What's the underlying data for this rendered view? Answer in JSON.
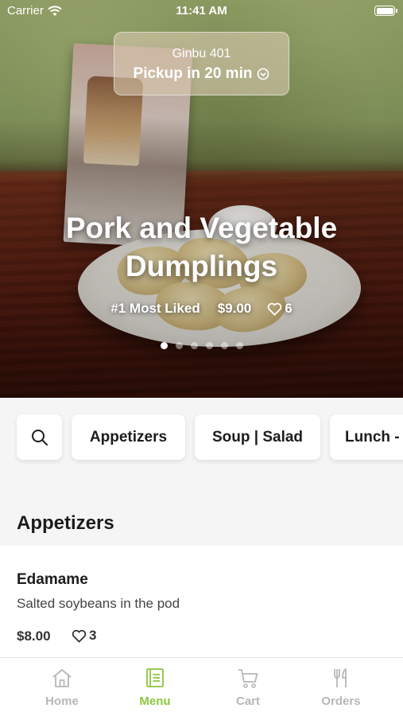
{
  "status_bar": {
    "carrier": "Carrier",
    "time": "11:41 AM",
    "battery_level": 1.0
  },
  "pickup": {
    "store_name": "Ginbu 401",
    "pickup_text": "Pickup in 20 min"
  },
  "featured": {
    "title": "Pork and Vegetable Dumplings",
    "rank": "#1 Most Liked",
    "price": "$9.00",
    "likes": "6",
    "carousel_count": 6,
    "carousel_active": 0
  },
  "categories": [
    "Appetizers",
    "Soup | Salad",
    "Lunch -"
  ],
  "section": {
    "title": "Appetizers"
  },
  "items": [
    {
      "name": "Edamame",
      "description": "Salted soybeans in the pod",
      "price": "$8.00",
      "likes": "3"
    }
  ],
  "tabs": [
    {
      "label": "Home",
      "icon": "home-icon"
    },
    {
      "label": "Menu",
      "icon": "menu-book-icon"
    },
    {
      "label": "Cart",
      "icon": "cart-icon"
    },
    {
      "label": "Orders",
      "icon": "fork-knife-icon"
    }
  ],
  "colors": {
    "accent": "#8cc63f",
    "inactive": "#b7b7b7"
  }
}
